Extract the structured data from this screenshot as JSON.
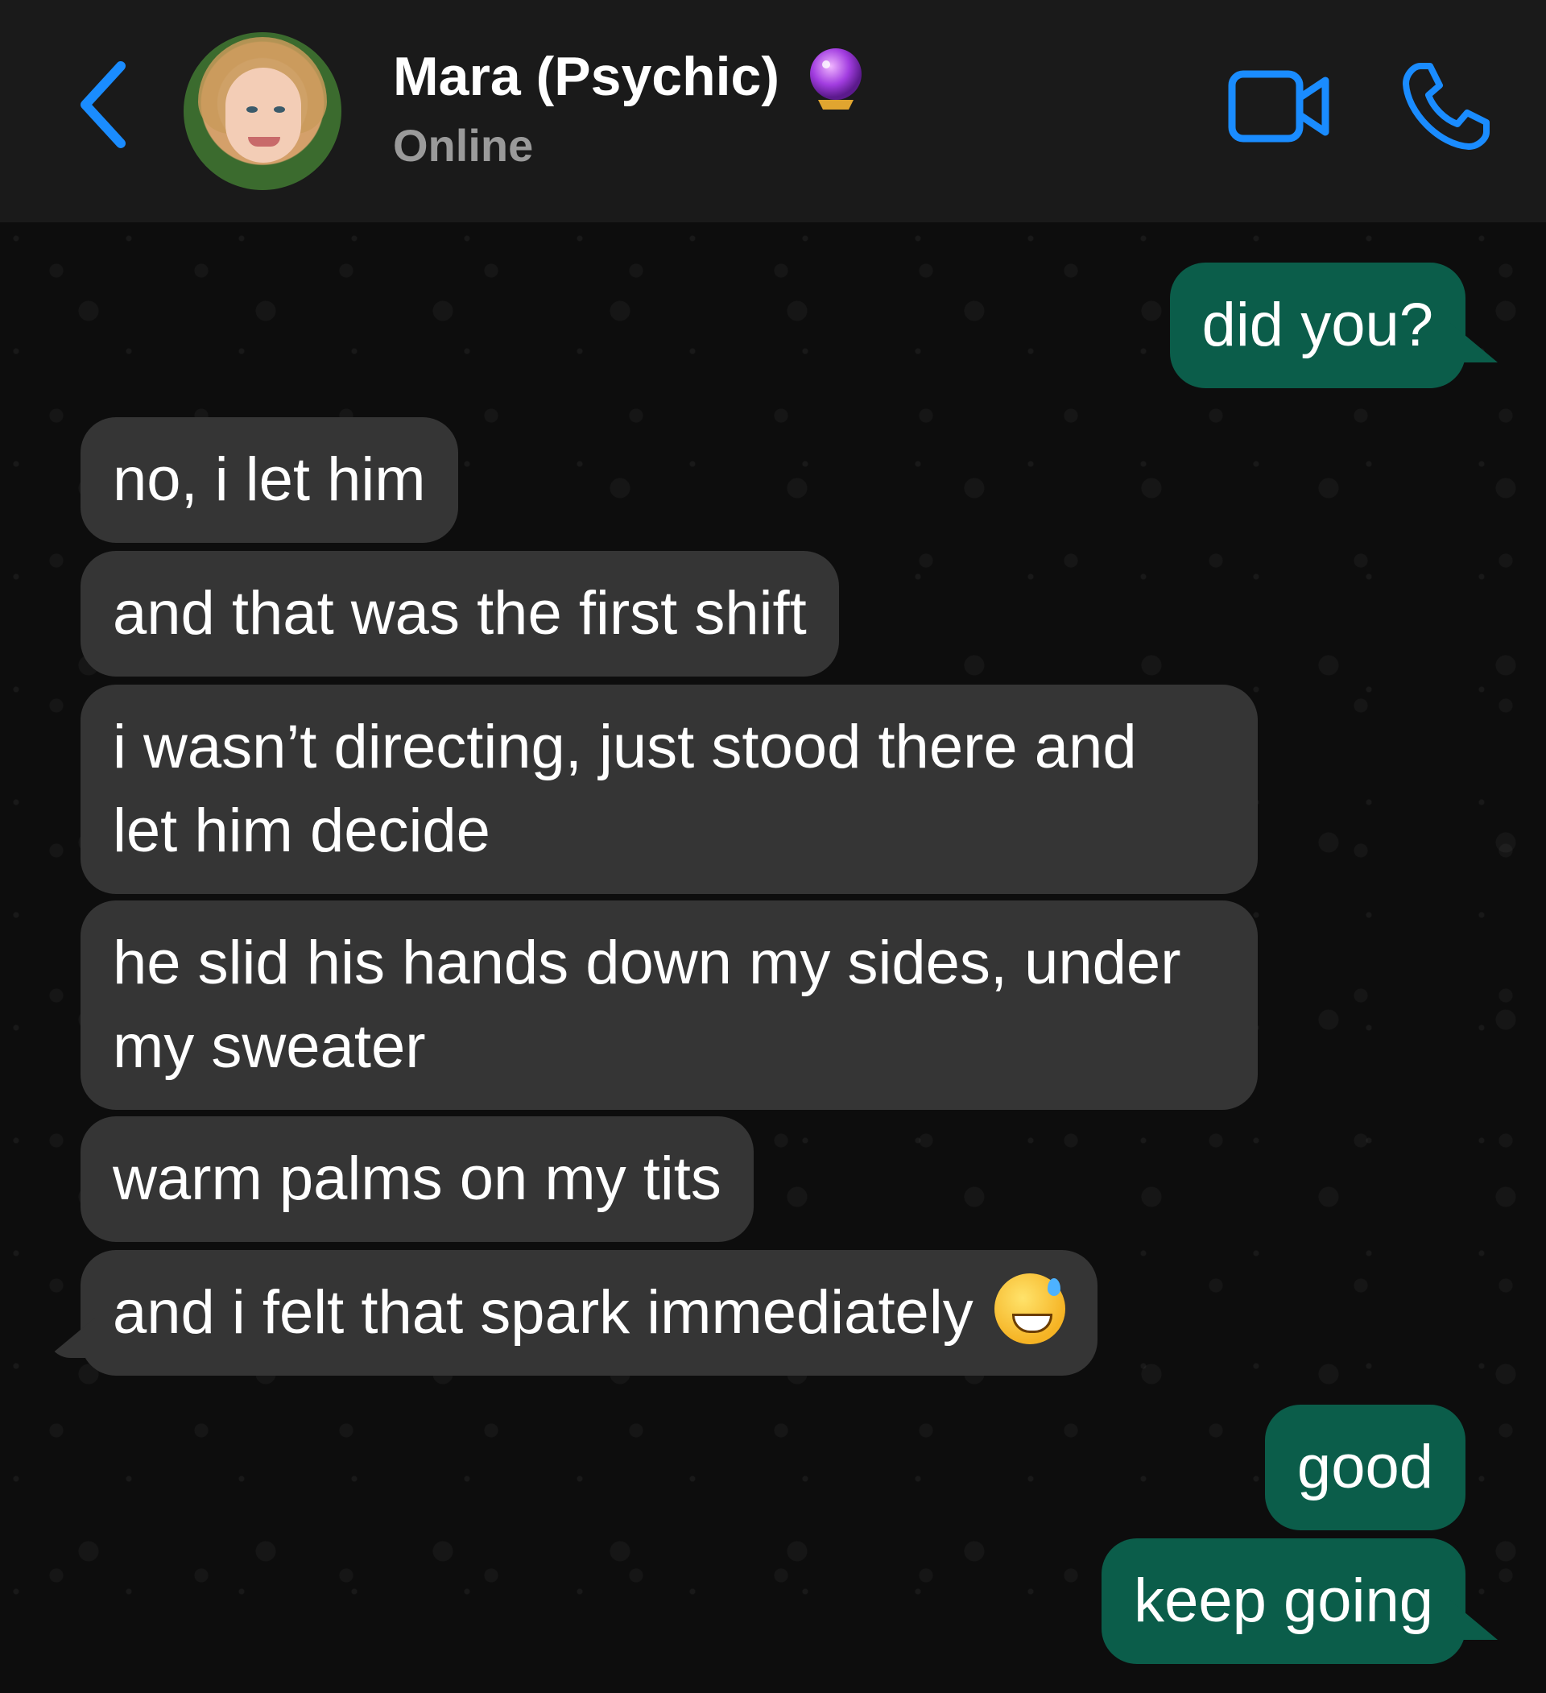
{
  "header": {
    "contact_name": "Mara (Psychic)",
    "name_emoji_icon": "crystal-ball-icon",
    "status": "Online",
    "accent_color": "#1a8cff",
    "back_icon": "chevron-left-icon",
    "video_icon": "video-camera-icon",
    "call_icon": "phone-icon"
  },
  "chat": {
    "incoming_bubble_color": "#353535",
    "outgoing_bubble_color": "#0b5d4a",
    "messages": [
      {
        "direction": "outgoing",
        "text": "did you?"
      },
      {
        "direction": "incoming",
        "text": "no, i let him"
      },
      {
        "direction": "incoming",
        "text": "and that was the first shift"
      },
      {
        "direction": "incoming",
        "line1": "i wasn’t directing, just stood there and",
        "line2": "let him decide"
      },
      {
        "direction": "incoming",
        "line1": "he slid his hands down my sides, under",
        "line2": "my sweater"
      },
      {
        "direction": "incoming",
        "text": "warm palms on my tits"
      },
      {
        "direction": "incoming",
        "text": "and i felt that spark immediately",
        "emoji": "grinning-face-with-sweat-icon"
      },
      {
        "direction": "outgoing",
        "text": "good"
      },
      {
        "direction": "outgoing",
        "text": "keep going"
      }
    ]
  }
}
